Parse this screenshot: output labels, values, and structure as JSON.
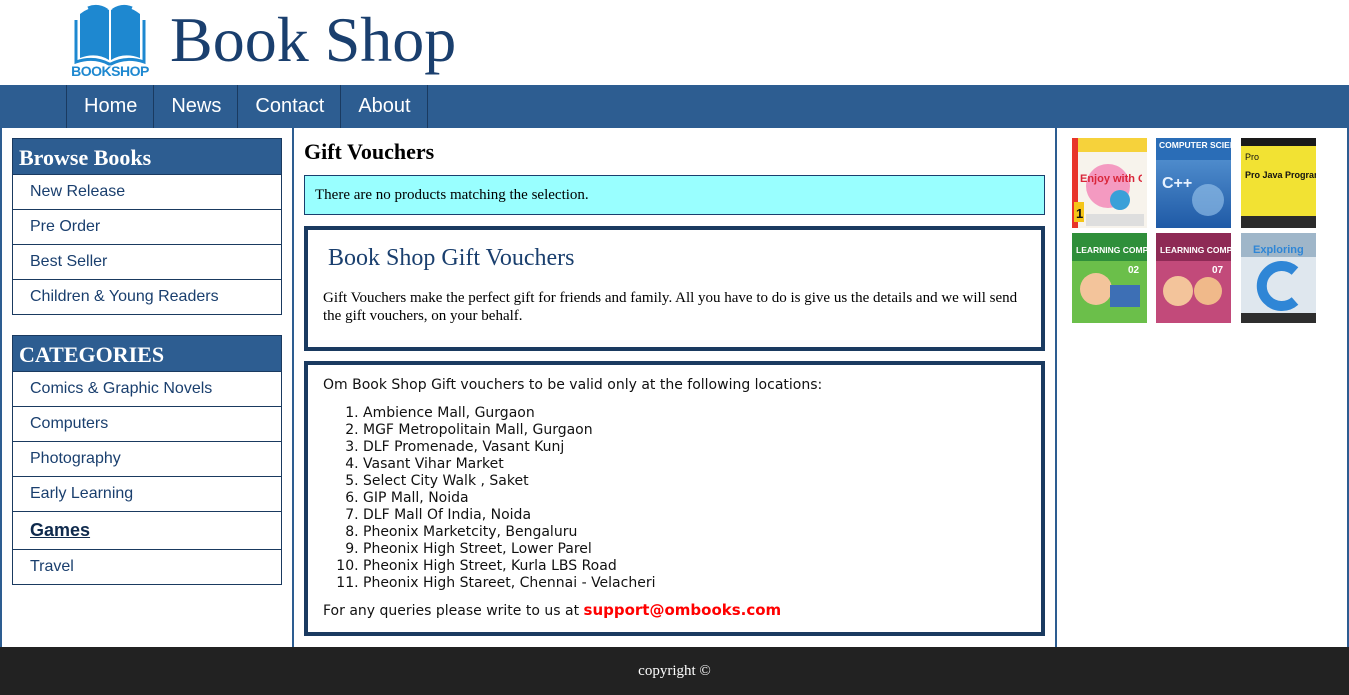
{
  "header": {
    "logo_text": "BOOKSHOP",
    "site_title": "Book Shop"
  },
  "nav": {
    "items": [
      {
        "label": "Home"
      },
      {
        "label": "News"
      },
      {
        "label": "Contact"
      },
      {
        "label": "About"
      }
    ]
  },
  "sidebar": {
    "browse": {
      "title": "Browse Books",
      "items": [
        {
          "label": "New Release"
        },
        {
          "label": "Pre Order"
        },
        {
          "label": "Best Seller"
        },
        {
          "label": "Children & Young Readers"
        }
      ]
    },
    "categories": {
      "title": "CATEGORIES",
      "items": [
        {
          "label": "Comics & Graphic Novels"
        },
        {
          "label": "Computers"
        },
        {
          "label": "Photography"
        },
        {
          "label": "Early Learning"
        },
        {
          "label": "Games",
          "active": true
        },
        {
          "label": "Travel"
        }
      ]
    }
  },
  "main": {
    "title": "Gift Vouchers",
    "notice": "There are no products matching the selection.",
    "voucher_heading": "Book Shop Gift Vouchers",
    "voucher_text": "Gift Vouchers make the perfect gift for friends and family. All you have to do is give us the details and we will send the gift vouchers, on your behalf.",
    "locations_intro": "Om Book Shop Gift vouchers to be valid only at the following locations:",
    "locations": [
      "Ambience Mall, Gurgaon",
      "MGF Metropolitain Mall, Gurgaon",
      "DLF Promenade, Vasant Kunj",
      "Vasant Vihar Market",
      "Select City Walk , Saket",
      "GIP Mall, Noida",
      "DLF Mall Of India, Noida",
      "Pheonix Marketcity, Bengaluru",
      "Pheonix High Street, Lower Parel",
      "Pheonix High Street, Kurla LBS Road",
      "Pheonix High Stareet, Chennai - Velacheri"
    ],
    "query_text": "For any queries please write to us at ",
    "email": "support@ombooks.com"
  },
  "books": [
    {
      "cover_title": "Enjoy with Computers",
      "badge": "1"
    },
    {
      "cover_title": "COMPUTER SCIENCE",
      "subtitle": "C++"
    },
    {
      "cover_title": "Pro Java Programming",
      "label": "Pro"
    },
    {
      "cover_title": "LEARNING COMPUTERS",
      "badge": "02"
    },
    {
      "cover_title": "LEARNING COMPUTERS",
      "badge": "07"
    },
    {
      "cover_title": "Exploring",
      "subtitle": "C"
    }
  ],
  "footer": {
    "copyright": "copyright ©"
  },
  "colors": {
    "brand_blue": "#2d5d91",
    "title_blue": "#1a3f6e",
    "notice_bg": "#99ffff",
    "email_red": "#ff0000",
    "footer_bg": "#222222"
  }
}
